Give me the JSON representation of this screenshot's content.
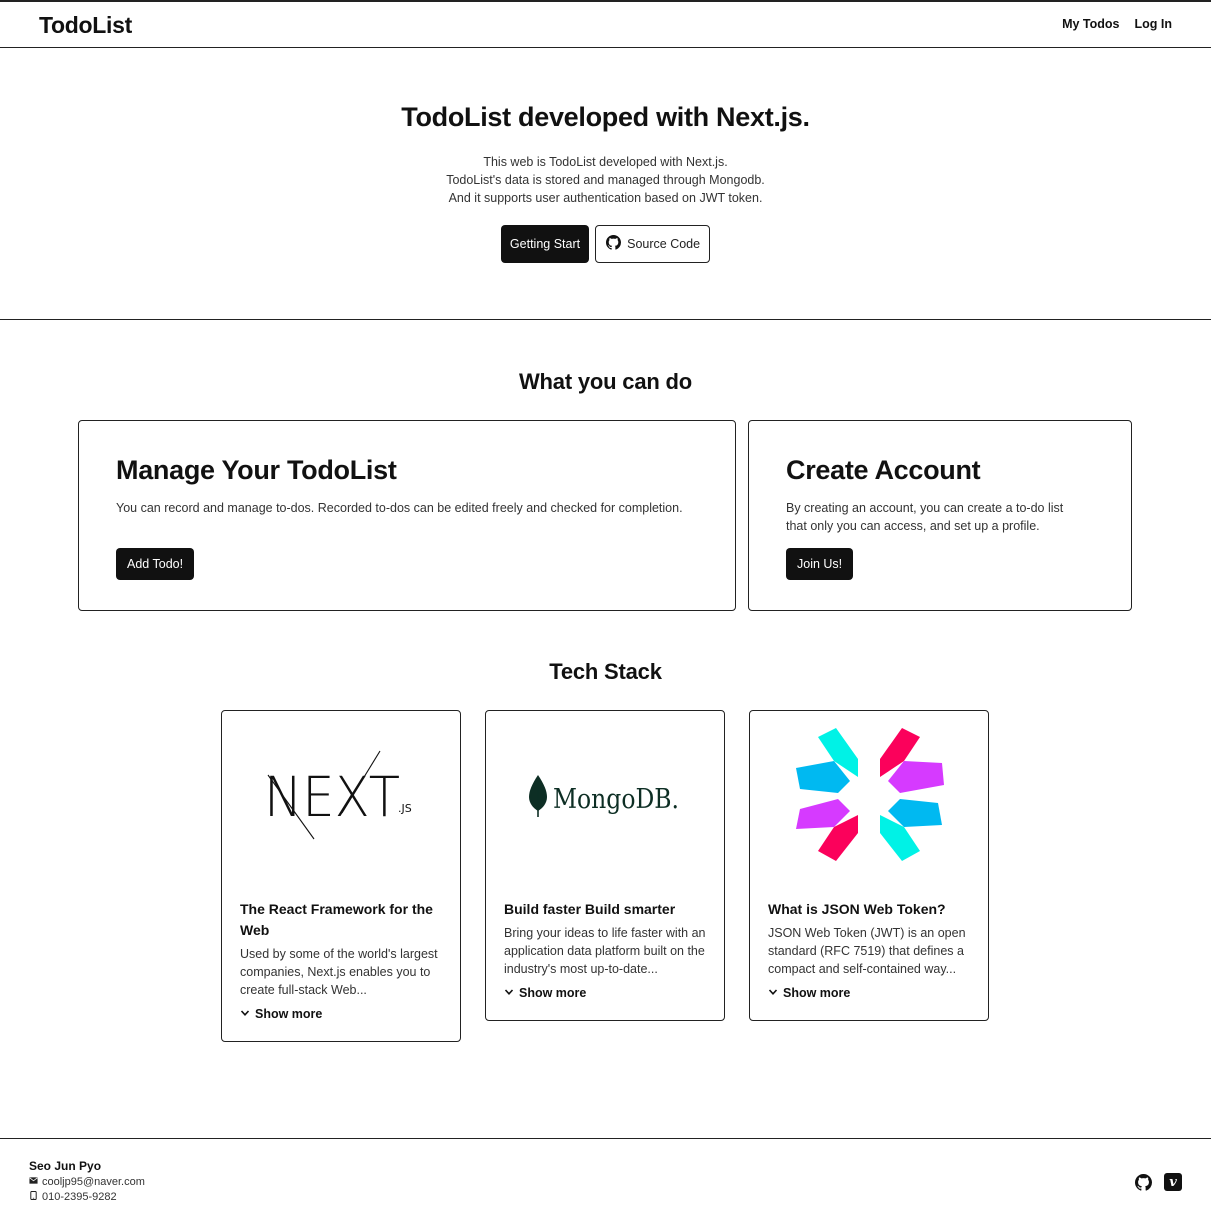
{
  "header": {
    "logo": "TodoList",
    "nav": [
      "My Todos",
      "Log In"
    ]
  },
  "hero": {
    "title": "TodoList developed with Next.js.",
    "description": [
      "This web is TodoList developed with Next.js.",
      "TodoList's data is stored and managed through Mongodb.",
      "And it supports user authentication based on JWT token."
    ],
    "primary_button": "Getting Start",
    "secondary_button": "Source Code"
  },
  "features": {
    "title": "What you can do",
    "cards": [
      {
        "title": "Manage Your TodoList",
        "text_lines": [
          "You can record and manage to-dos. Recorded to-dos can be edited freely and checked for completion."
        ],
        "button": "Add Todo!"
      },
      {
        "title": "Create Account",
        "text_lines": [
          "By creating an account, you can create a to-do list",
          "that only you can access, and set up a profile."
        ],
        "button": "Join Us!"
      }
    ]
  },
  "tech": {
    "title": "Tech Stack",
    "cards": [
      {
        "logo_text": "NEXT",
        "logo_subtext": ".JS",
        "heading": "The React Framework for the Web",
        "body": "Used by some of the world's largest companies, Next.js enables you to create full-stack Web...",
        "more": "Show more"
      },
      {
        "logo_text": "MongoDB.",
        "heading": "Build faster Build smarter",
        "body": "Bring your ideas to life faster with an application data platform built on the industry's most up-to-date...",
        "more": "Show more"
      },
      {
        "logo_icon": "jwt-logo-icon",
        "heading": "What is JSON Web Token?",
        "body": "JSON Web Token (JWT) is an open standard (RFC 7519) that defines a compact and self-contained way...",
        "more": "Show more"
      }
    ]
  },
  "footer": {
    "name": "Seo Jun Pyo",
    "email": "cooljp95@naver.com",
    "phone": "010-2395-9282",
    "social": [
      "github-icon",
      "velog-icon"
    ],
    "velog_glyph": "v"
  },
  "colors": {
    "primary": "#111111",
    "jwt_cyan": "#00b9f1",
    "jwt_teal": "#00f2e6",
    "jwt_pink": "#fb015b",
    "jwt_purple": "#d63aff",
    "mongo_green": "#13aa52"
  }
}
